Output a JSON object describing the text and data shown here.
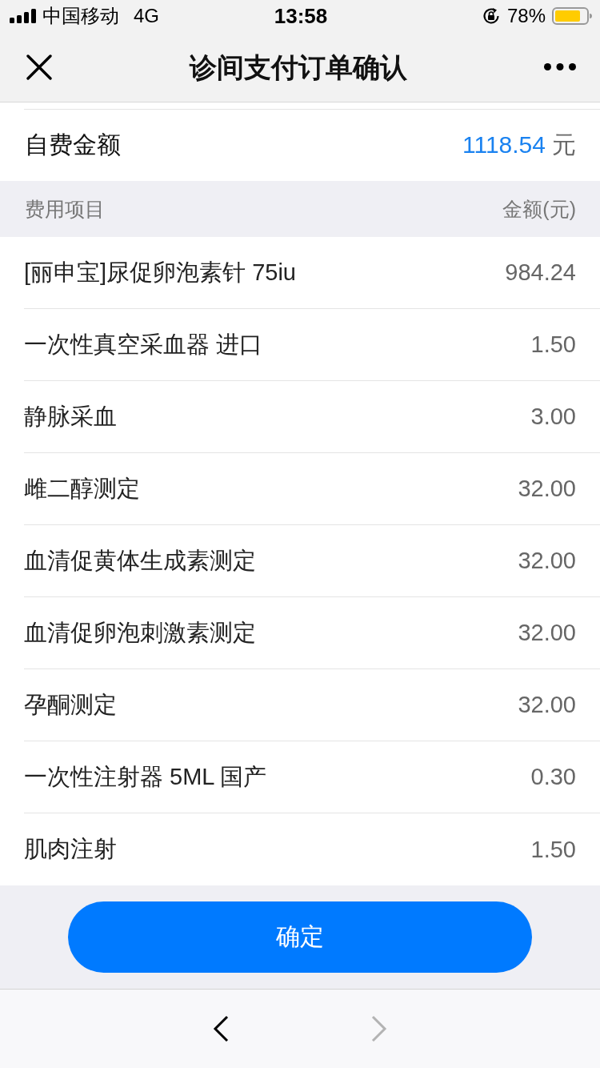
{
  "status_bar": {
    "carrier": "中国移动",
    "network": "4G",
    "time": "13:58",
    "battery": "78%"
  },
  "nav_bar": {
    "title": "诊间支付订单确认"
  },
  "summary": {
    "label": "自费金额",
    "amount": "1118.54",
    "unit": "元"
  },
  "table": {
    "columns": [
      "费用项目",
      "金额(元)"
    ],
    "rows": [
      {
        "item": "[丽申宝]尿促卵泡素针 75iu",
        "amount": "984.24"
      },
      {
        "item": "一次性真空采血器 进口",
        "amount": "1.50"
      },
      {
        "item": "静脉采血",
        "amount": "3.00"
      },
      {
        "item": "雌二醇测定",
        "amount": "32.00"
      },
      {
        "item": "血清促黄体生成素测定",
        "amount": "32.00"
      },
      {
        "item": "血清促卵泡刺激素测定",
        "amount": "32.00"
      },
      {
        "item": "孕酮测定",
        "amount": "32.00"
      },
      {
        "item": "一次性注射器 5ML 国产",
        "amount": "0.30"
      },
      {
        "item": "肌肉注射",
        "amount": "1.50"
      }
    ]
  },
  "confirm_button": {
    "label": "确定"
  },
  "browser_toolbar": [
    {
      "kind": "back",
      "disabled": false
    },
    {
      "kind": "forward",
      "disabled": true
    }
  ]
}
